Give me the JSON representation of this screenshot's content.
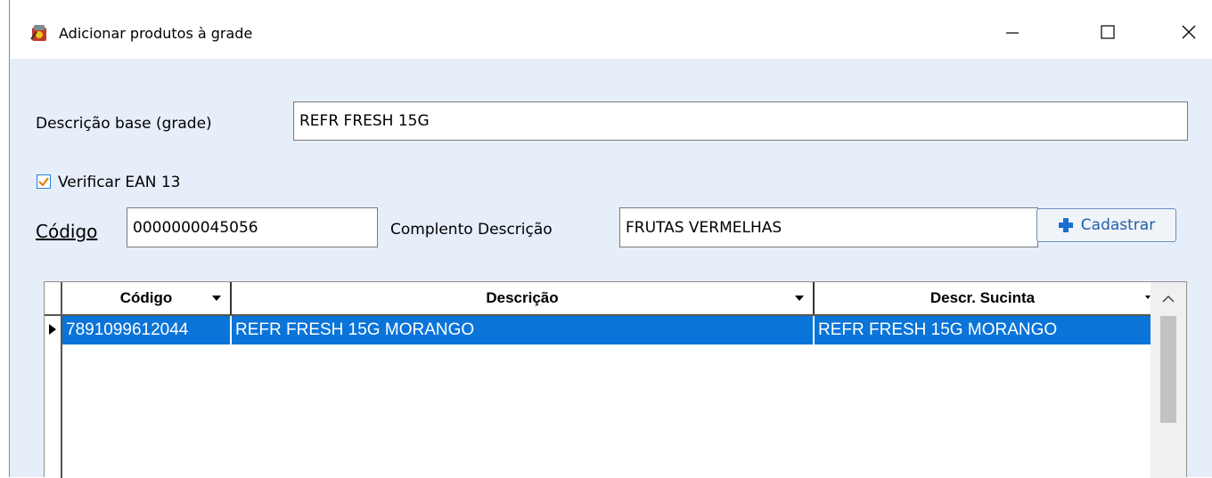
{
  "window": {
    "title": "Adicionar produtos à grade",
    "controls": {
      "minimize": "—",
      "maximize": "☐",
      "close": "✕"
    }
  },
  "form": {
    "descricao_base_label": "Descrição base (grade)",
    "descricao_base_value": "REFR FRESH 15G",
    "verificar_ean_label": "Verificar EAN 13",
    "verificar_ean_checked": true,
    "codigo_label": "Código",
    "codigo_value": "0000000045056",
    "complemento_label": "Complento Descrição",
    "complemento_value": "FRUTAS VERMELHAS",
    "cadastrar_label": "Cadastrar"
  },
  "grid": {
    "columns": [
      "Código",
      "Descrição",
      "Descr. Sucinta"
    ],
    "rows": [
      [
        "7891099612044",
        "REFR FRESH 15G MORANGO",
        "REFR FRESH 15G MORANGO"
      ]
    ]
  },
  "colors": {
    "selection": "#0a74d8",
    "window_bg": "#e6eefa",
    "checkmark": "#e07b00",
    "plus_icon": "#1b6fd0"
  }
}
